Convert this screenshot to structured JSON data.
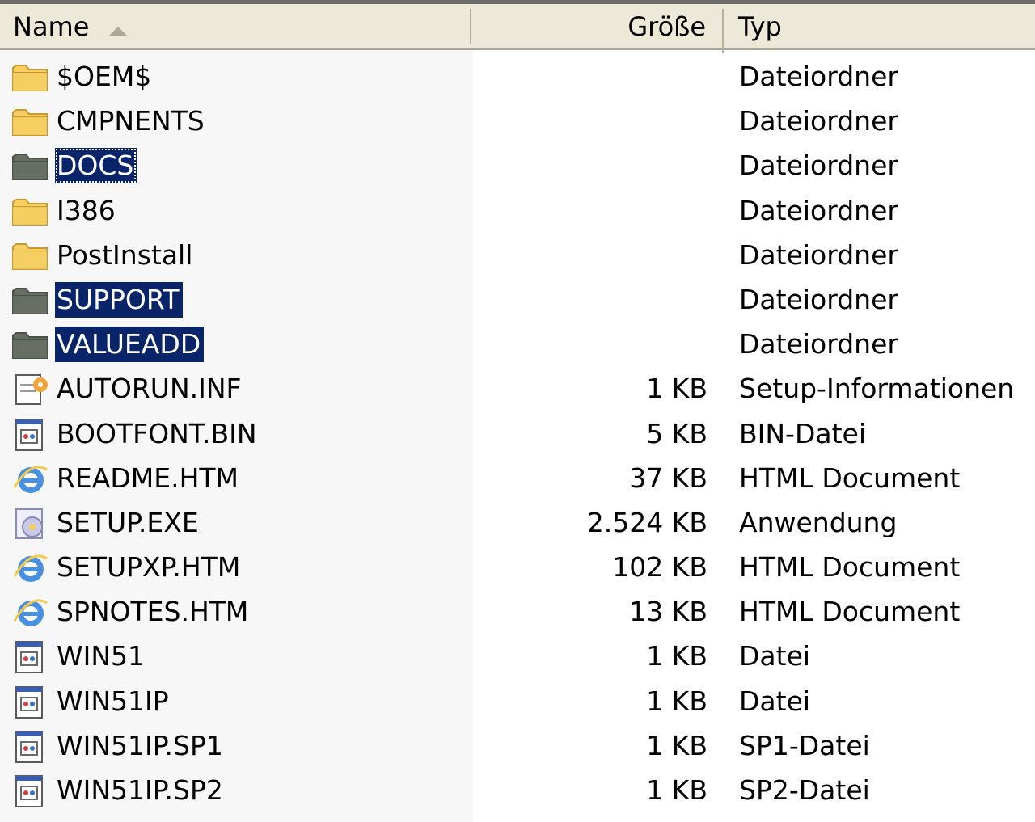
{
  "header": {
    "name_label": "Name",
    "size_label": "Größe",
    "type_label": "Typ"
  },
  "files": [
    {
      "name": "$OEM$",
      "size": "",
      "type": "Dateiordner",
      "icon": "folder",
      "selected": false
    },
    {
      "name": "CMPNENTS",
      "size": "",
      "type": "Dateiordner",
      "icon": "folder",
      "selected": false
    },
    {
      "name": "DOCS",
      "size": "",
      "type": "Dateiordner",
      "icon": "folder",
      "selected": true,
      "focused": true
    },
    {
      "name": "I386",
      "size": "",
      "type": "Dateiordner",
      "icon": "folder",
      "selected": false
    },
    {
      "name": "PostInstall",
      "size": "",
      "type": "Dateiordner",
      "icon": "folder",
      "selected": false
    },
    {
      "name": "SUPPORT",
      "size": "",
      "type": "Dateiordner",
      "icon": "folder",
      "selected": true
    },
    {
      "name": "VALUEADD",
      "size": "",
      "type": "Dateiordner",
      "icon": "folder",
      "selected": true
    },
    {
      "name": "AUTORUN.INF",
      "size": "1 KB",
      "type": "Setup-Informationen",
      "icon": "inf",
      "selected": false
    },
    {
      "name": "BOOTFONT.BIN",
      "size": "5 KB",
      "type": "BIN-Datei",
      "icon": "generic",
      "selected": false
    },
    {
      "name": "README.HTM",
      "size": "37 KB",
      "type": "HTML Document",
      "icon": "ie",
      "selected": false
    },
    {
      "name": "SETUP.EXE",
      "size": "2.524 KB",
      "type": "Anwendung",
      "icon": "setup",
      "selected": false
    },
    {
      "name": "SETUPXP.HTM",
      "size": "102 KB",
      "type": "HTML Document",
      "icon": "ie",
      "selected": false
    },
    {
      "name": "SPNOTES.HTM",
      "size": "13 KB",
      "type": "HTML Document",
      "icon": "ie",
      "selected": false
    },
    {
      "name": "WIN51",
      "size": "1 KB",
      "type": "Datei",
      "icon": "generic",
      "selected": false
    },
    {
      "name": "WIN51IP",
      "size": "1 KB",
      "type": "Datei",
      "icon": "generic",
      "selected": false
    },
    {
      "name": "WIN51IP.SP1",
      "size": "1 KB",
      "type": "SP1-Datei",
      "icon": "generic",
      "selected": false
    },
    {
      "name": "WIN51IP.SP2",
      "size": "1 KB",
      "type": "SP2-Datei",
      "icon": "generic",
      "selected": false
    }
  ],
  "colors": {
    "selection": "#0a246a",
    "header_bg": "#ece9d8",
    "folder": "#f5cf62",
    "folder_selected": "#676f63"
  }
}
